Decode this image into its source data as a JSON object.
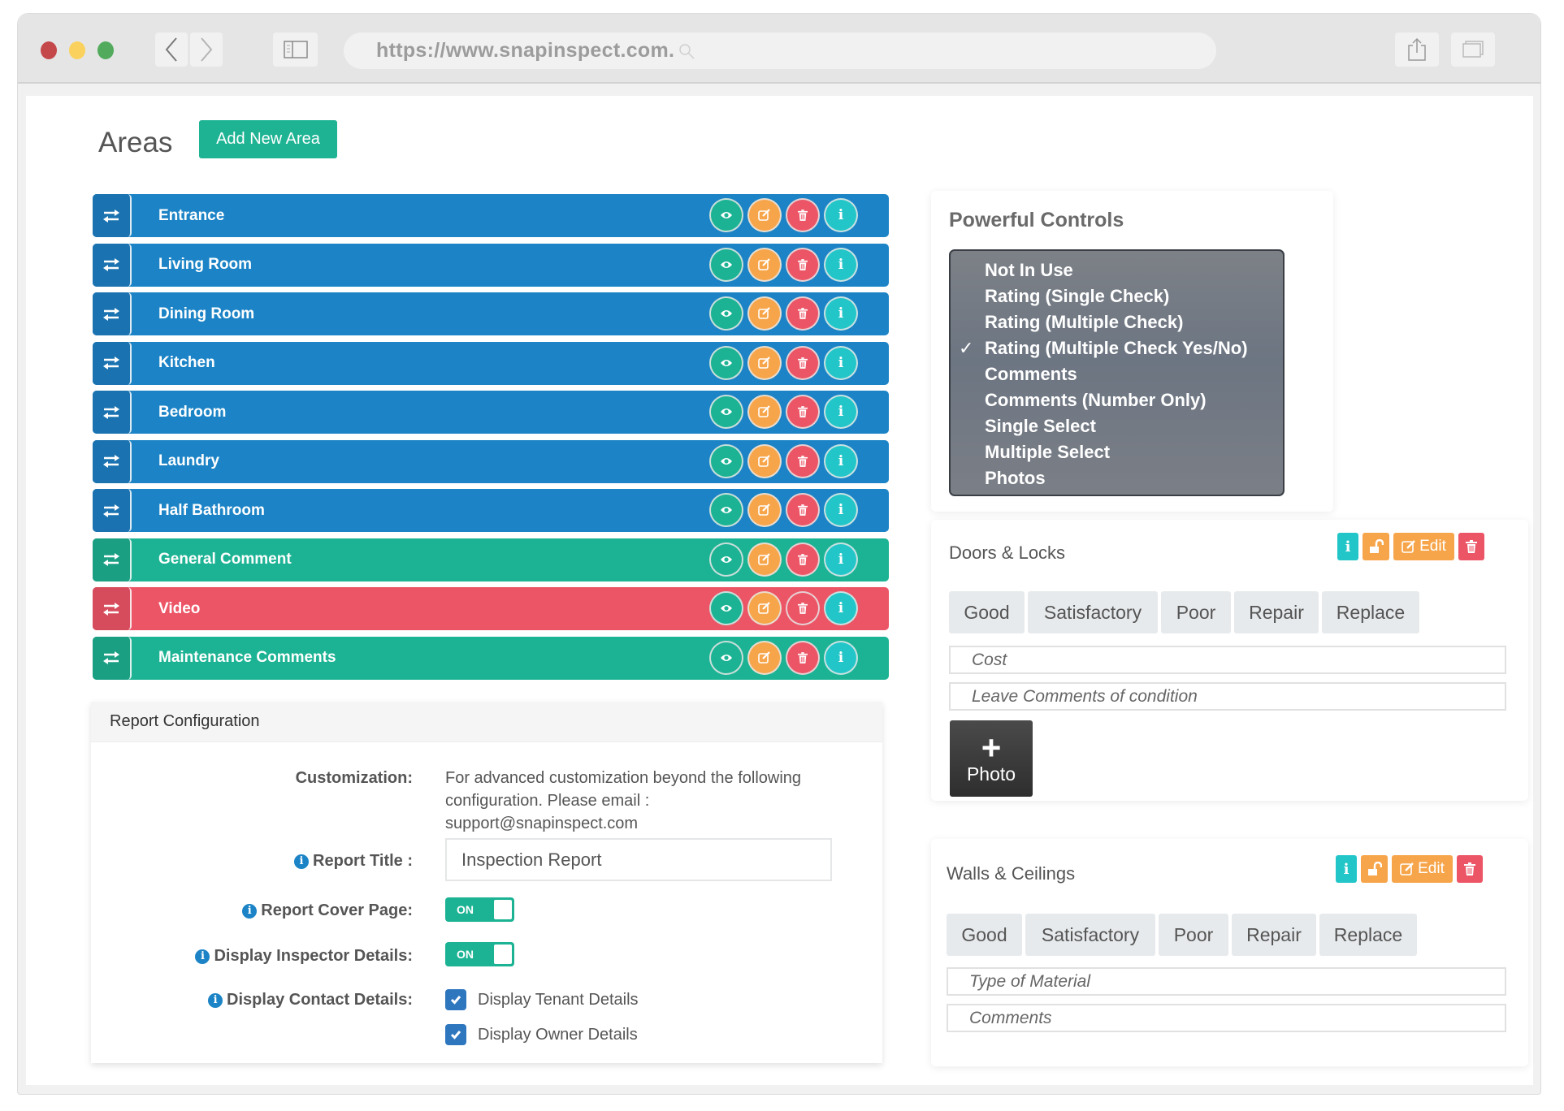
{
  "browser": {
    "url": "https://www.snapinspect.com.",
    "icons": [
      "close-dot",
      "minimize-dot",
      "maximize-dot",
      "back-icon",
      "forward-icon",
      "sidebar-icon",
      "search-icon",
      "share-icon",
      "tabs-icon"
    ]
  },
  "areas": {
    "title": "Areas",
    "add_button": "Add New Area",
    "rows": [
      {
        "name": "Entrance",
        "color": "blue"
      },
      {
        "name": "Living Room",
        "color": "blue"
      },
      {
        "name": "Dining Room",
        "color": "blue"
      },
      {
        "name": "Kitchen",
        "color": "blue"
      },
      {
        "name": "Bedroom",
        "color": "blue"
      },
      {
        "name": "Laundry",
        "color": "blue"
      },
      {
        "name": "Half Bathroom",
        "color": "blue"
      },
      {
        "name": "General Comment",
        "color": "green"
      },
      {
        "name": "Video",
        "color": "red"
      },
      {
        "name": "Maintenance Comments",
        "color": "green"
      }
    ],
    "row_actions": [
      "view",
      "edit",
      "delete",
      "info"
    ]
  },
  "report_config": {
    "title": "Report Configuration",
    "customization_label": "Customization:",
    "customization_text": "For advanced customization beyond the following configuration. Please email : support@snapinspect.com",
    "report_title_label": "Report Title :",
    "report_title_value": "Inspection Report",
    "cover_page_label": "Report Cover Page:",
    "cover_page_state": "ON",
    "inspector_label": "Display Inspector Details:",
    "inspector_state": "ON",
    "contact_label": "Display Contact Details:",
    "tenant_label": "Display Tenant Details",
    "tenant_checked": true,
    "owner_label": "Display Owner Details",
    "owner_checked": true
  },
  "powerful_controls": {
    "title": "Powerful Controls",
    "options": [
      {
        "label": "Not In Use",
        "selected": false
      },
      {
        "label": "Rating (Single Check)",
        "selected": false
      },
      {
        "label": "Rating (Multiple Check)",
        "selected": false
      },
      {
        "label": "Rating (Multiple Check Yes/No)",
        "selected": true
      },
      {
        "label": "Comments",
        "selected": false
      },
      {
        "label": "Comments (Number Only)",
        "selected": false
      },
      {
        "label": "Single Select",
        "selected": false
      },
      {
        "label": "Multiple Select",
        "selected": false
      },
      {
        "label": "Photos",
        "selected": false
      }
    ],
    "check_glyph": "✓"
  },
  "items": [
    {
      "title": "Doors & Locks",
      "edit_label": "Edit",
      "ratings": [
        "Good",
        "Satisfactory",
        "Poor",
        "Repair",
        "Replace"
      ],
      "fields": [
        "Cost",
        "Leave Comments of condition"
      ],
      "photo_label": "Photo",
      "photo_plus": "+"
    },
    {
      "title": "Walls & Ceilings",
      "edit_label": "Edit",
      "ratings": [
        "Good",
        "Satisfactory",
        "Poor",
        "Repair",
        "Replace"
      ],
      "fields": [
        "Type of Material",
        "Comments"
      ]
    }
  ],
  "colors": {
    "blue": "#1c84c6",
    "green": "#1cb394",
    "red": "#ec5566",
    "orange": "#f7a54a",
    "cyan": "#23c6c8"
  }
}
